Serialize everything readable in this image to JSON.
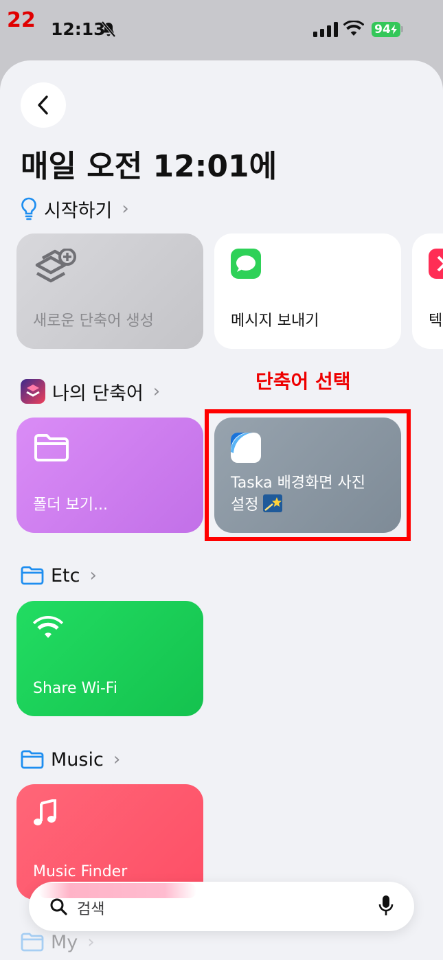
{
  "status": {
    "step_number": "22",
    "time": "12:13",
    "battery": "94"
  },
  "title": "매일 오전 12:01에",
  "sections": {
    "getting_started": {
      "label": "시작하기"
    },
    "my_shortcuts": {
      "label": "나의 단축어"
    },
    "etc": {
      "label": "Etc"
    },
    "music": {
      "label": "Music"
    },
    "my": {
      "label": "My"
    }
  },
  "tiles": {
    "new_shortcut": "새로운 단축어 생성",
    "send_message": "메시지 보내기",
    "partial": "텍",
    "folder_view": "폴더 보기...",
    "taska_line1": "Taska 배경화면 사진",
    "taska_line2": "설정",
    "share_wifi": "Share Wi-Fi",
    "music_finder": "Music Finder"
  },
  "annotation": "단축어 선택",
  "search": {
    "placeholder": "검색"
  },
  "colors": {
    "purple_tile": "#d07ef0",
    "gray_tile": "#8694a1",
    "green_tile": "#1ed05a",
    "red_tile": "#ff5a6e",
    "accent_blue": "#1e8ef0",
    "highlight_red": "#ff0000"
  }
}
